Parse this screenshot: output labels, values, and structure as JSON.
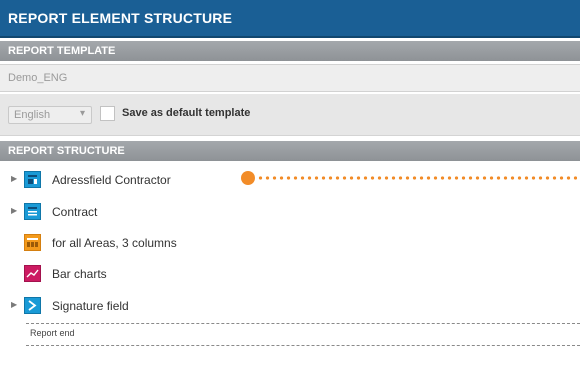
{
  "window": {
    "title": "REPORT ELEMENT STRUCTURE"
  },
  "report_template": {
    "header": "REPORT TEMPLATE",
    "template_name": "Demo_ENG",
    "language": "English",
    "save_default_label": "Save as default template",
    "save_default_checked": false
  },
  "report_structure": {
    "header": "REPORT STRUCTURE",
    "items": [
      {
        "label": "Adressfield Contractor",
        "icon": "address-field-icon",
        "color": "#1a9ad6",
        "expandable": true
      },
      {
        "label": "Contract",
        "icon": "text-block-icon",
        "color": "#1a9ad6",
        "expandable": true
      },
      {
        "label": "for all Areas, 3 columns",
        "icon": "table-icon",
        "color": "#f39a1c",
        "expandable": false
      },
      {
        "label": "Bar charts",
        "icon": "bar-chart-icon",
        "color": "#cc1b62",
        "expandable": false
      },
      {
        "label": "Signature field",
        "icon": "signature-icon",
        "color": "#1a9ad6",
        "expandable": true
      }
    ],
    "end_label": "Report end"
  },
  "colors": {
    "title_bar": "#1a5f95",
    "section_header": "#9a9ea2",
    "callout": "#f28c28"
  }
}
